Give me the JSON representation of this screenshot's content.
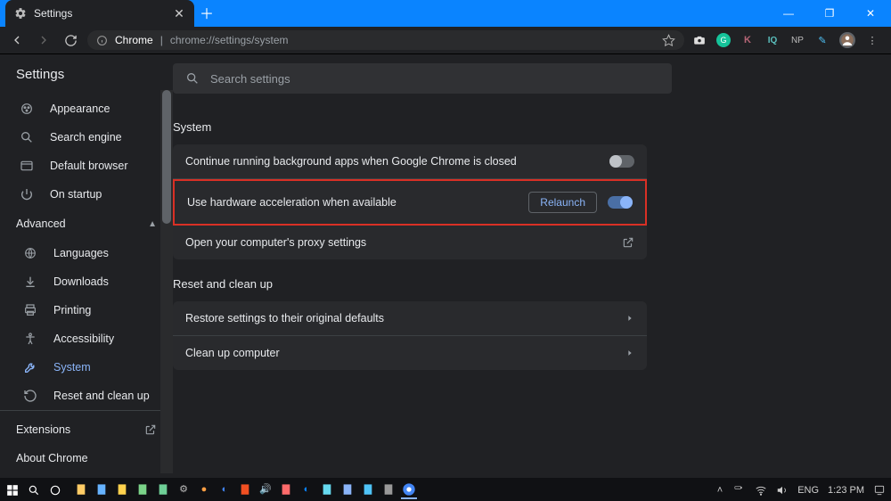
{
  "window": {
    "tab_title": "Settings",
    "url_host": "Chrome",
    "url_sep": " | ",
    "url_path": "chrome://settings/system"
  },
  "extensions_bar": [
    {
      "name": "camera",
      "bg": "",
      "fg": "#ddd",
      "glyph": "📷"
    },
    {
      "name": "grammarly",
      "bg": "#15c39a",
      "fg": "#fff",
      "glyph": "●"
    },
    {
      "name": "k",
      "bg": "",
      "fg": "#b56576",
      "glyph": "K"
    },
    {
      "name": "iq",
      "bg": "",
      "fg": "#5bc0be",
      "glyph": "IQ"
    },
    {
      "name": "np",
      "bg": "",
      "fg": "#bbb",
      "glyph": "NP"
    },
    {
      "name": "pen",
      "bg": "",
      "fg": "#4fc3f7",
      "glyph": "✎"
    }
  ],
  "app": {
    "title": "Settings",
    "search_placeholder": "Search settings"
  },
  "sidebar": {
    "items_top": [
      {
        "icon": "brush",
        "label": "Appearance"
      },
      {
        "icon": "search",
        "label": "Search engine"
      },
      {
        "icon": "browser",
        "label": "Default browser"
      },
      {
        "icon": "power",
        "label": "On startup"
      }
    ],
    "advanced_label": "Advanced",
    "items_advanced": [
      {
        "icon": "globe",
        "label": "Languages"
      },
      {
        "icon": "download",
        "label": "Downloads"
      },
      {
        "icon": "printer",
        "label": "Printing"
      },
      {
        "icon": "accessibility",
        "label": "Accessibility"
      },
      {
        "icon": "wrench",
        "label": "System",
        "active": true
      },
      {
        "icon": "restore",
        "label": "Reset and clean up"
      }
    ],
    "extensions": "Extensions",
    "about": "About Chrome"
  },
  "main": {
    "system_title": "System",
    "rows": {
      "bg_apps": "Continue running background apps when Google Chrome is closed",
      "hw_accel": "Use hardware acceleration when available",
      "relaunch": "Relaunch",
      "proxy": "Open your computer's proxy settings"
    },
    "reset_title": "Reset and clean up",
    "reset_rows": {
      "restore": "Restore settings to their original defaults",
      "cleanup": "Clean up computer"
    }
  },
  "taskbar": {
    "lang": "ENG",
    "time": "1:23 PM"
  }
}
